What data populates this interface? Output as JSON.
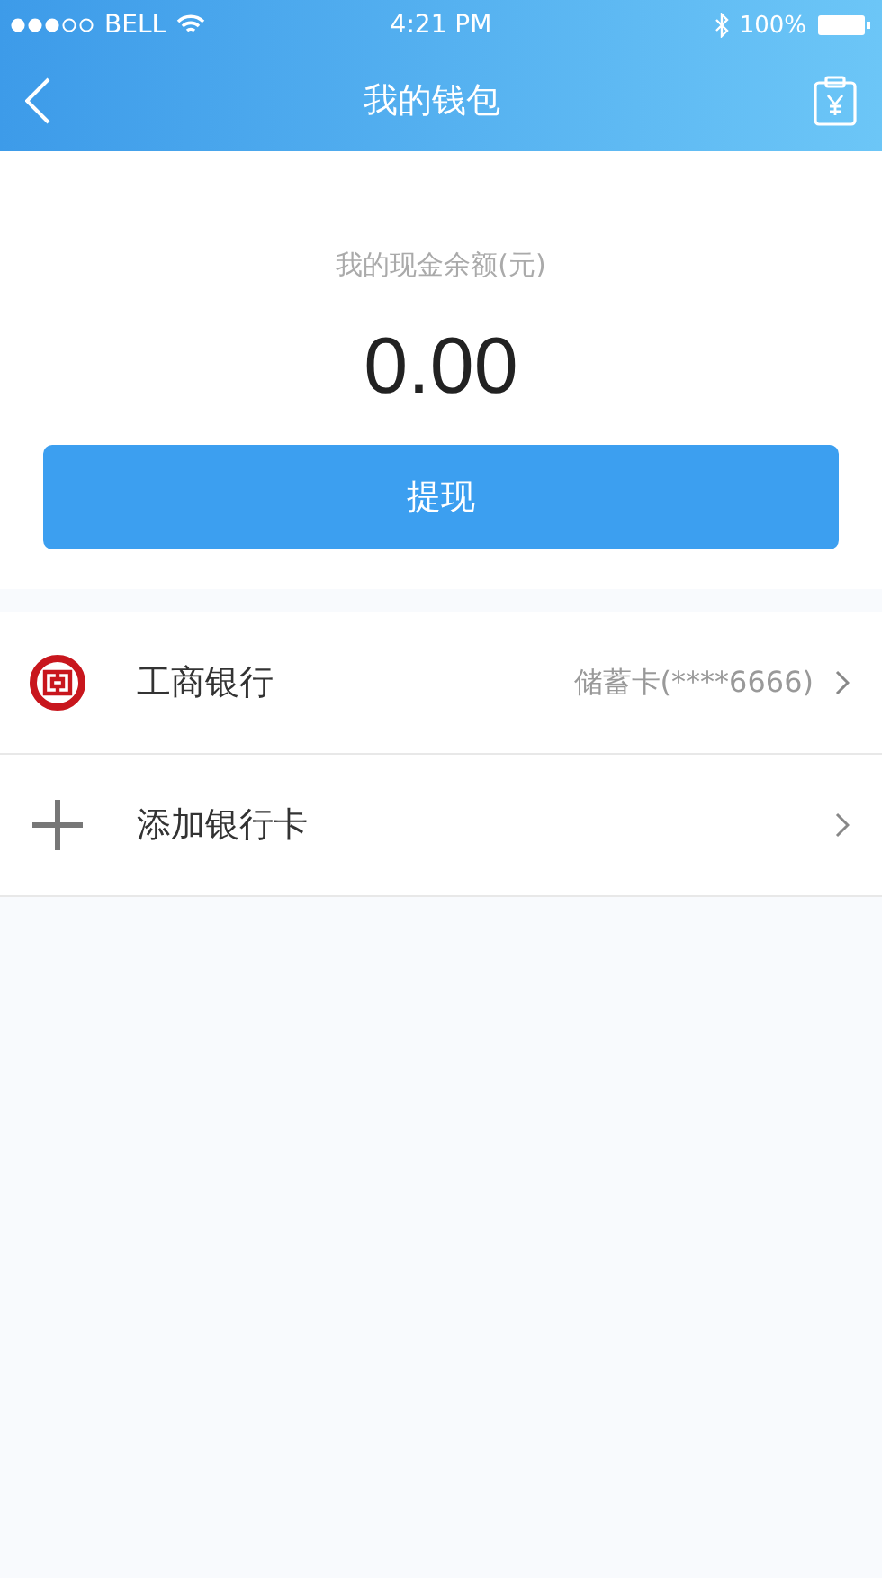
{
  "status_bar": {
    "carrier": "BELL",
    "time": "4:21 PM",
    "battery": "100%"
  },
  "nav": {
    "title": "我的钱包"
  },
  "balance": {
    "label": "我的现金余额(元)",
    "amount": "0.00",
    "button": "提现"
  },
  "rows": [
    {
      "kind": "bank",
      "label": "工商银行",
      "detail": "储蓄卡(****6666)"
    },
    {
      "kind": "add",
      "label": "添加银行卡"
    }
  ]
}
